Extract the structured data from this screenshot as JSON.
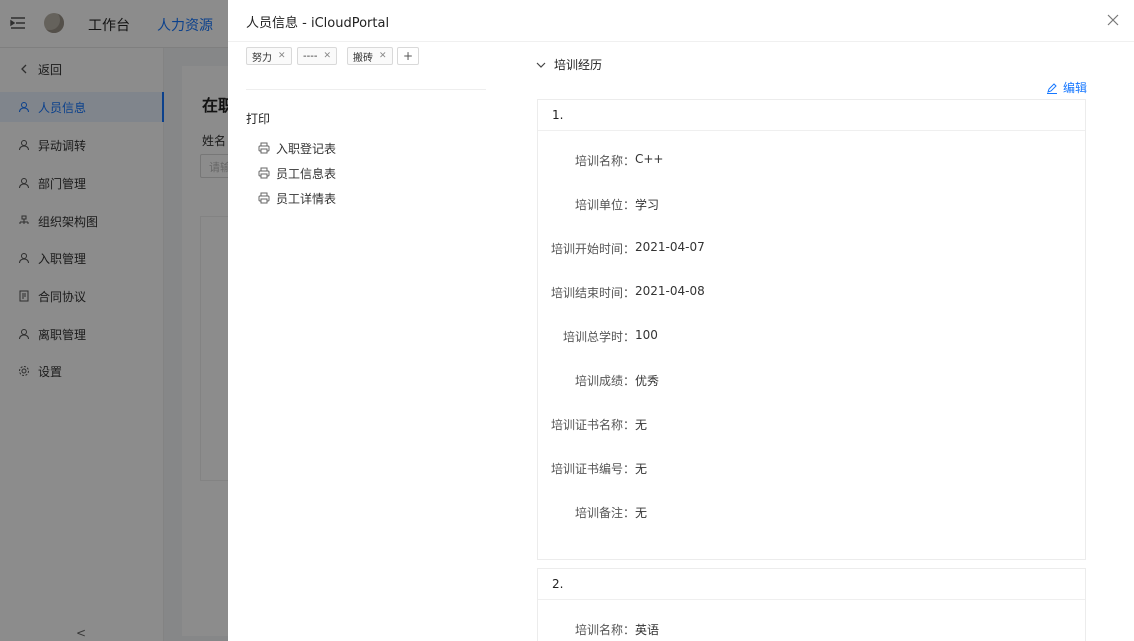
{
  "topbar": {
    "nav": [
      "工作台",
      "人力资源"
    ]
  },
  "sidebar": {
    "items": [
      {
        "label": "返回",
        "icon": "chevron-left-icon"
      },
      {
        "label": "人员信息",
        "icon": "user-icon",
        "active": true
      },
      {
        "label": "异动调转",
        "icon": "user-icon"
      },
      {
        "label": "部门管理",
        "icon": "user-icon"
      },
      {
        "label": "组织架构图",
        "icon": "org-chart-icon"
      },
      {
        "label": "入职管理",
        "icon": "user-icon"
      },
      {
        "label": "合同协议",
        "icon": "document-icon"
      },
      {
        "label": "离职管理",
        "icon": "user-icon"
      },
      {
        "label": "设置",
        "icon": "gear-icon"
      }
    ],
    "collapse_glyph": "<"
  },
  "background": {
    "card_title": "在职",
    "name_label": "姓名",
    "name_placeholder": "请输"
  },
  "drawer": {
    "title": "人员信息 - iCloudPortal",
    "tags": [
      {
        "label": "努力"
      },
      {
        "label": "----"
      },
      {
        "label": "搬砖"
      }
    ],
    "add_tag": "+",
    "print": {
      "title": "打印",
      "items": [
        "入职登记表",
        "员工信息表",
        "员工详情表"
      ]
    },
    "section": {
      "title": "培训经历",
      "edit_label": "编辑"
    },
    "records": [
      {
        "num": "1.",
        "fields": [
          {
            "k": "培训名称：",
            "v": "C++"
          },
          {
            "k": "培训单位：",
            "v": "学习"
          },
          {
            "k": "培训开始时间：",
            "v": "2021-04-07"
          },
          {
            "k": "培训结束时间：",
            "v": "2021-04-08"
          },
          {
            "k": "培训总学时：",
            "v": "100"
          },
          {
            "k": "培训成绩：",
            "v": "优秀"
          },
          {
            "k": "培训证书名称：",
            "v": "无"
          },
          {
            "k": "培训证书编号：",
            "v": "无"
          },
          {
            "k": "培训备注：",
            "v": "无"
          }
        ]
      },
      {
        "num": "2.",
        "fields": [
          {
            "k": "培训名称：",
            "v": "英语"
          }
        ]
      }
    ]
  },
  "colors": {
    "accent": "#1677ff",
    "mask": "rgba(0,0,0,0.45)"
  }
}
